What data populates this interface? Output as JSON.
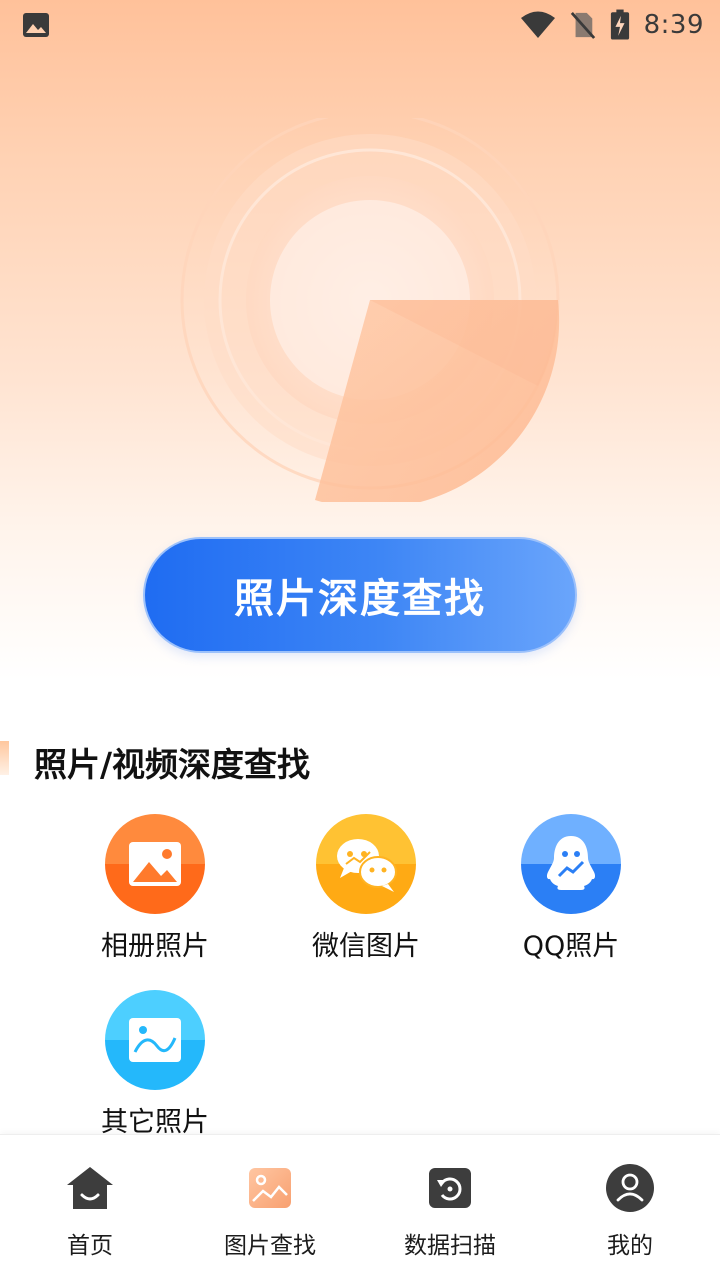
{
  "status_bar": {
    "time": "8:39",
    "icons": [
      "image-icon",
      "wifi-icon",
      "no-sim-icon",
      "battery-charging-icon"
    ]
  },
  "scanner": {
    "icon": "radar-scan-icon"
  },
  "main_button": {
    "label": "照片深度查找"
  },
  "section": {
    "title": "照片/视频深度查找"
  },
  "categories": [
    {
      "label": "相册照片",
      "icon": "album-photo-icon",
      "color_top": "#ff8a3d",
      "color_bottom": "#ff6a1a"
    },
    {
      "label": "微信图片",
      "icon": "wechat-icon",
      "color_top": "#ffc233",
      "color_bottom": "#ffaa14"
    },
    {
      "label": "QQ照片",
      "icon": "qq-icon",
      "color_top": "#5aa5ff",
      "color_bottom": "#2b7ff5"
    },
    {
      "label": "其它照片",
      "icon": "other-photo-icon",
      "color_top": "#4dcfff",
      "color_bottom": "#24b8fb"
    }
  ],
  "bottom_nav": [
    {
      "label": "首页",
      "icon": "home-icon"
    },
    {
      "label": "图片查找",
      "icon": "picture-search-icon"
    },
    {
      "label": "数据扫描",
      "icon": "data-scan-icon"
    },
    {
      "label": "我的",
      "icon": "profile-icon"
    }
  ]
}
